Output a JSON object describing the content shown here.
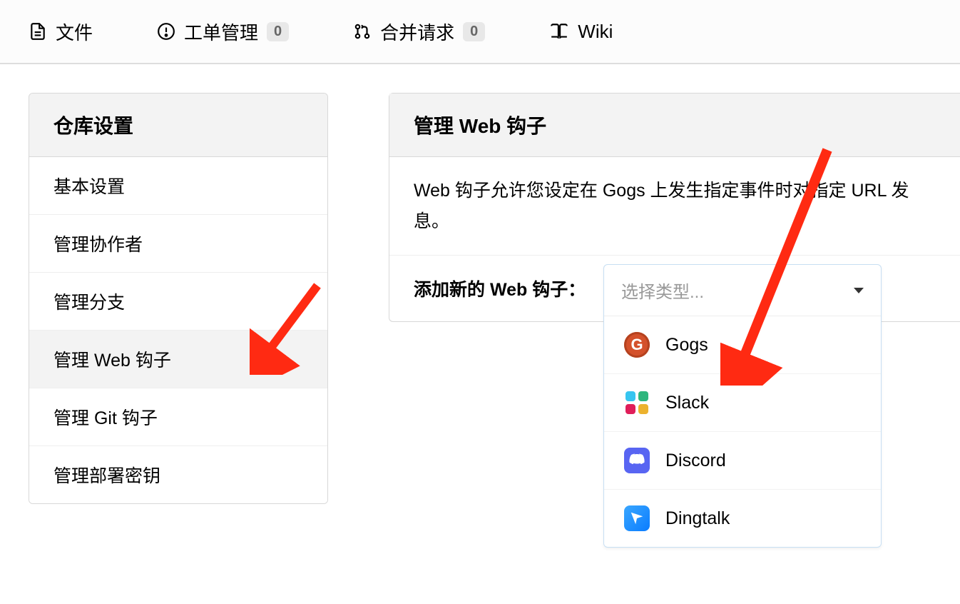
{
  "topnav": {
    "files": "文件",
    "issues": "工单管理",
    "issues_count": "0",
    "pulls": "合并请求",
    "pulls_count": "0",
    "wiki": "Wiki"
  },
  "sidebar": {
    "title": "仓库设置",
    "items": [
      {
        "label": "基本设置"
      },
      {
        "label": "管理协作者"
      },
      {
        "label": "管理分支"
      },
      {
        "label": "管理 Web 钩子",
        "active": true
      },
      {
        "label": "管理 Git 钩子"
      },
      {
        "label": "管理部署密钥"
      }
    ]
  },
  "panel": {
    "title": "管理 Web 钩子",
    "description": "Web 钩子允许您设定在 Gogs 上发生指定事件时对指定 URL 发息。",
    "add_label": "添加新的 Web 钩子：",
    "dropdown_placeholder": "选择类型...",
    "options": [
      {
        "name": "Gogs"
      },
      {
        "name": "Slack"
      },
      {
        "name": "Discord"
      },
      {
        "name": "Dingtalk"
      }
    ]
  }
}
